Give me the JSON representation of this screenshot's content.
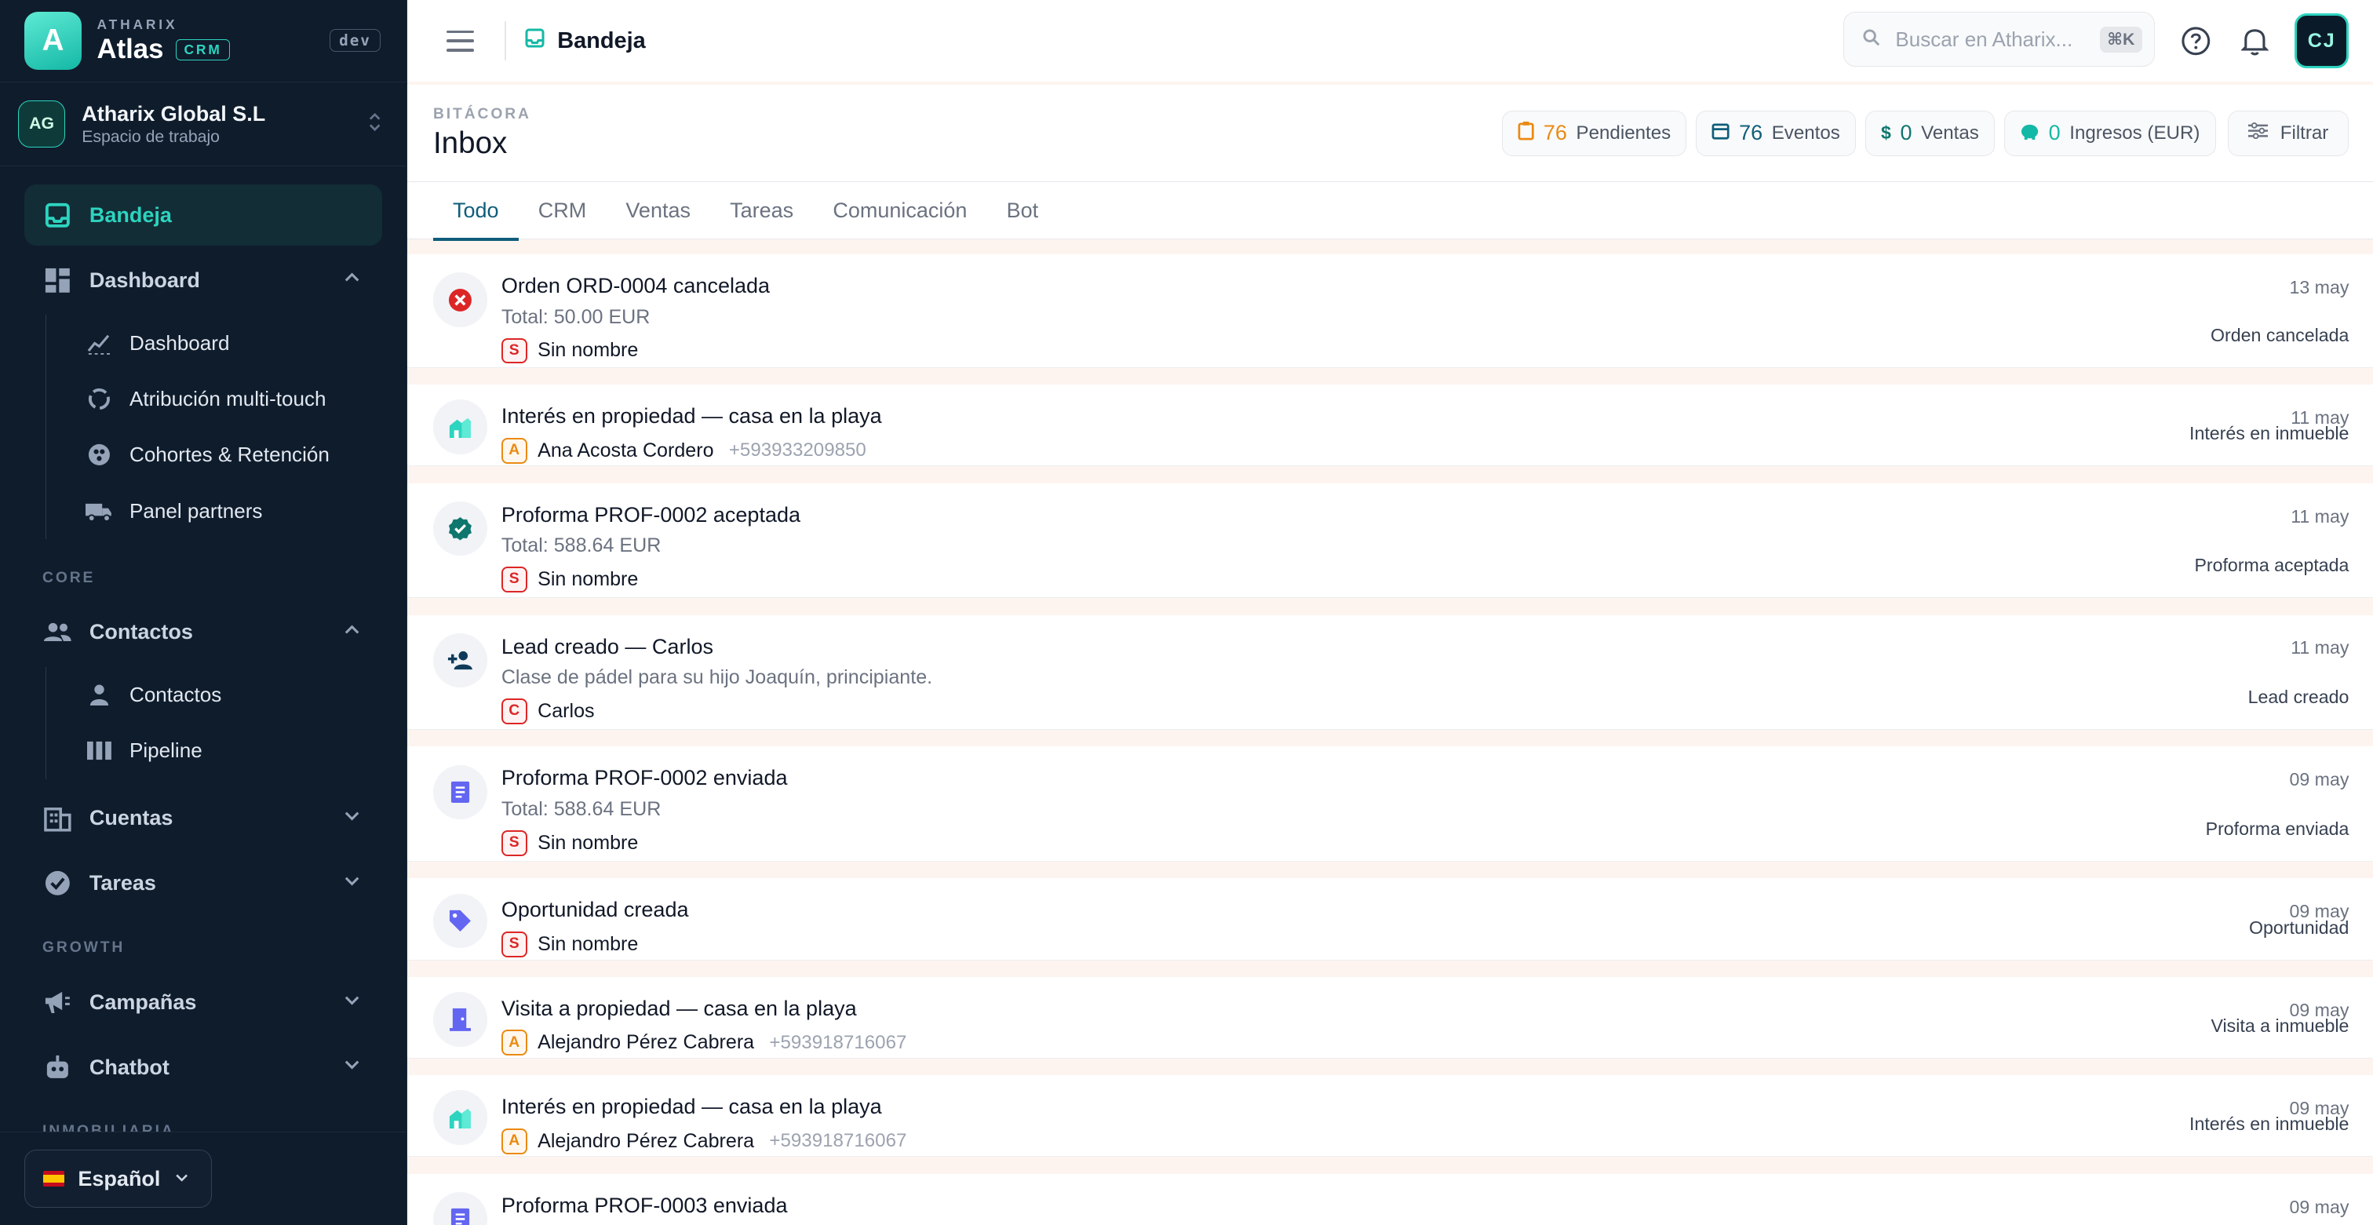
{
  "brand": {
    "sub": "ATHARIX",
    "name": "Atlas",
    "badge": "CRM",
    "env": "dev",
    "logo_letter": "A"
  },
  "workspace": {
    "initials": "AG",
    "name": "Atharix Global S.L",
    "subtitle": "Espacio de trabajo"
  },
  "sidebar": {
    "primary": {
      "label": "Bandeja",
      "icon": "inbox-icon"
    },
    "dashboard_group": {
      "label": "Dashboard",
      "items": [
        {
          "label": "Dashboard",
          "icon": "trend-icon"
        },
        {
          "label": "Atribución multi-touch",
          "icon": "circle-arrows-icon"
        },
        {
          "label": "Cohortes & Retención",
          "icon": "cohort-icon"
        },
        {
          "label": "Panel partners",
          "icon": "truck-icon"
        }
      ]
    },
    "section_core": "CORE",
    "contacts_group": {
      "label": "Contactos",
      "items": [
        {
          "label": "Contactos",
          "icon": "person-icon"
        },
        {
          "label": "Pipeline",
          "icon": "columns-icon"
        }
      ]
    },
    "cuentas": "Cuentas",
    "tareas": "Tareas",
    "section_growth": "GROWTH",
    "campanas": "Campañas",
    "chatbot": "Chatbot",
    "section_inmo": "INMOBILIARIA",
    "language": "Español"
  },
  "topbar": {
    "breadcrumb": "Bandeja",
    "search_placeholder": "Buscar en Atharix...",
    "search_shortcut": "⌘K",
    "user_initials": "CJ"
  },
  "page": {
    "eyebrow": "BITÁCORA",
    "title": "Inbox",
    "stats": [
      {
        "value": "76",
        "label": "Pendientes",
        "color": "#ea8a12"
      },
      {
        "value": "76",
        "label": "Eventos",
        "color": "#0f5d7a"
      },
      {
        "value": "0",
        "label": "Ventas",
        "color": "#0f766e"
      },
      {
        "value": "0",
        "label": "Ingresos (EUR)",
        "color": "#14b8a6"
      }
    ],
    "filter_label": "Filtrar",
    "tabs": [
      "Todo",
      "CRM",
      "Ventas",
      "Tareas",
      "Comunicación",
      "Bot"
    ]
  },
  "feed": [
    {
      "title": "Orden ORD-0004 cancelada",
      "sub": "Total: 50.00 EUR",
      "initial": "S",
      "person": "Sin nombre",
      "phone": "",
      "date": "13 may",
      "type": "Orden cancelada",
      "icon": "cancel-icon"
    },
    {
      "title": "Interés en propiedad — casa en la playa",
      "sub": "",
      "initial": "A",
      "person": "Ana Acosta Cordero",
      "phone": "+593933209850",
      "date": "11 may",
      "type": "Interés en inmueble",
      "icon": "property-icon"
    },
    {
      "title": "Proforma PROF-0002 aceptada",
      "sub": "Total: 588.64 EUR",
      "initial": "S",
      "person": "Sin nombre",
      "phone": "",
      "date": "11 may",
      "type": "Proforma aceptada",
      "icon": "verified-icon"
    },
    {
      "title": "Lead creado — Carlos",
      "sub": "Clase de pádel para su hijo Joaquín, principiante.",
      "initial": "C",
      "person": "Carlos",
      "phone": "",
      "date": "11 may",
      "type": "Lead creado",
      "icon": "person-add-icon"
    },
    {
      "title": "Proforma PROF-0002 enviada",
      "sub": "Total: 588.64 EUR",
      "initial": "S",
      "person": "Sin nombre",
      "phone": "",
      "date": "09 may",
      "type": "Proforma enviada",
      "icon": "receipt-icon"
    },
    {
      "title": "Oportunidad creada",
      "sub": "",
      "initial": "S",
      "person": "Sin nombre",
      "phone": "",
      "date": "09 may",
      "type": "Oportunidad",
      "icon": "tag-icon"
    },
    {
      "title": "Visita a propiedad — casa en la playa",
      "sub": "",
      "initial": "A",
      "person": "Alejandro Pérez Cabrera",
      "phone": "+593918716067",
      "date": "09 may",
      "type": "Visita a inmueble",
      "icon": "door-icon"
    },
    {
      "title": "Interés en propiedad — casa en la playa",
      "sub": "",
      "initial": "A",
      "person": "Alejandro Pérez Cabrera",
      "phone": "+593918716067",
      "date": "09 may",
      "type": "Interés en inmueble",
      "icon": "property-icon"
    },
    {
      "title": "Proforma PROF-0003 enviada",
      "sub": "",
      "initial": "",
      "person": "",
      "phone": "",
      "date": "09 may",
      "type": "",
      "icon": "receipt-icon"
    }
  ]
}
